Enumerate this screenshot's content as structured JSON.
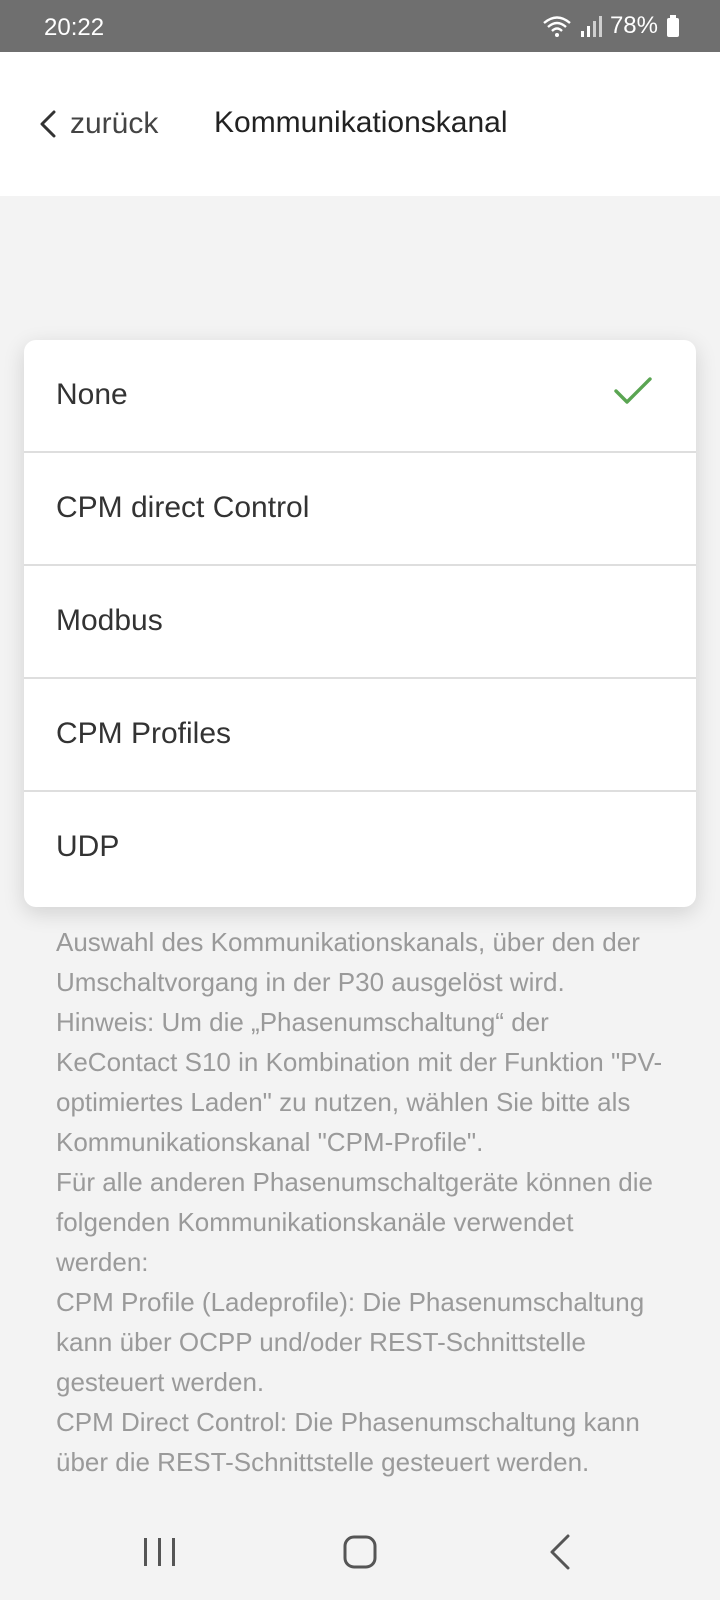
{
  "status_bar": {
    "time": "20:22",
    "battery": "78%",
    "icons": [
      "wifi-icon",
      "signal-icon",
      "battery-icon"
    ]
  },
  "header": {
    "back_label": "zurück",
    "title": "Kommunikationskanal"
  },
  "options": [
    {
      "label": "None",
      "selected": true
    },
    {
      "label": "CPM direct Control",
      "selected": false
    },
    {
      "label": "Modbus",
      "selected": false
    },
    {
      "label": "CPM Profiles",
      "selected": false
    },
    {
      "label": "UDP",
      "selected": false
    }
  ],
  "colors": {
    "check": "#5aa552",
    "status_bar": "#6f6f6f",
    "background": "#f3f3f3"
  },
  "description": {
    "lines": [
      "Auswahl des Kommunikationskanals, über den der Umschaltvorgang in der P30 ausgelöst wird.",
      "Hinweis: Um die „Phasenumschaltung“ der KeContact S10 in Kombination mit der Funktion \"PV-optimiertes Laden\" zu nutzen, wählen Sie bitte als Kommunikationskanal \"CPM-Profile\".",
      "Für alle anderen Phasenumschaltgeräte können die folgenden Kommunikationskanäle verwendet werden:",
      "CPM Profile (Ladeprofile): Die Phasenumschaltung kann über OCPP und/oder REST-Schnittstelle gesteuert werden.",
      "CPM Direct Control: Die Phasenumschaltung kann über die REST-Schnittstelle gesteuert werden."
    ]
  },
  "nav_bar": {
    "icons": [
      "recent-apps-icon",
      "home-icon",
      "back-icon"
    ]
  }
}
